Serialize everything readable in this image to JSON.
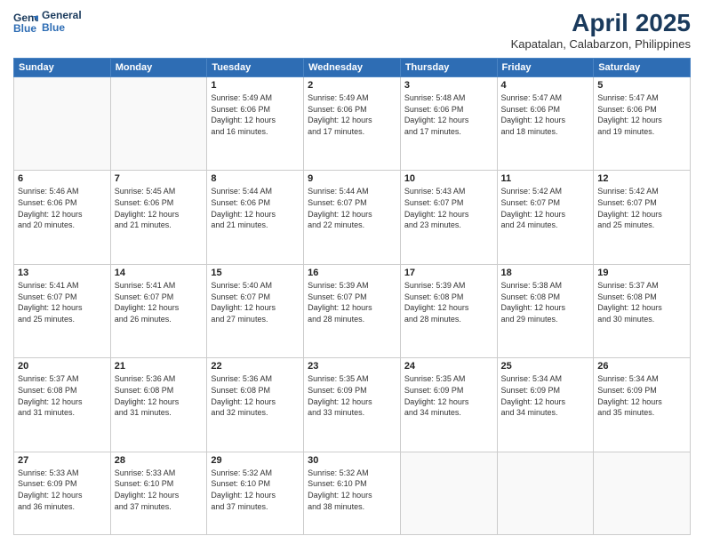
{
  "header": {
    "logo_line1": "General",
    "logo_line2": "Blue",
    "month_year": "April 2025",
    "location": "Kapatalan, Calabarzon, Philippines"
  },
  "weekdays": [
    "Sunday",
    "Monday",
    "Tuesday",
    "Wednesday",
    "Thursday",
    "Friday",
    "Saturday"
  ],
  "weeks": [
    [
      {
        "day": "",
        "info": ""
      },
      {
        "day": "",
        "info": ""
      },
      {
        "day": "1",
        "info": "Sunrise: 5:49 AM\nSunset: 6:06 PM\nDaylight: 12 hours\nand 16 minutes."
      },
      {
        "day": "2",
        "info": "Sunrise: 5:49 AM\nSunset: 6:06 PM\nDaylight: 12 hours\nand 17 minutes."
      },
      {
        "day": "3",
        "info": "Sunrise: 5:48 AM\nSunset: 6:06 PM\nDaylight: 12 hours\nand 17 minutes."
      },
      {
        "day": "4",
        "info": "Sunrise: 5:47 AM\nSunset: 6:06 PM\nDaylight: 12 hours\nand 18 minutes."
      },
      {
        "day": "5",
        "info": "Sunrise: 5:47 AM\nSunset: 6:06 PM\nDaylight: 12 hours\nand 19 minutes."
      }
    ],
    [
      {
        "day": "6",
        "info": "Sunrise: 5:46 AM\nSunset: 6:06 PM\nDaylight: 12 hours\nand 20 minutes."
      },
      {
        "day": "7",
        "info": "Sunrise: 5:45 AM\nSunset: 6:06 PM\nDaylight: 12 hours\nand 21 minutes."
      },
      {
        "day": "8",
        "info": "Sunrise: 5:44 AM\nSunset: 6:06 PM\nDaylight: 12 hours\nand 21 minutes."
      },
      {
        "day": "9",
        "info": "Sunrise: 5:44 AM\nSunset: 6:07 PM\nDaylight: 12 hours\nand 22 minutes."
      },
      {
        "day": "10",
        "info": "Sunrise: 5:43 AM\nSunset: 6:07 PM\nDaylight: 12 hours\nand 23 minutes."
      },
      {
        "day": "11",
        "info": "Sunrise: 5:42 AM\nSunset: 6:07 PM\nDaylight: 12 hours\nand 24 minutes."
      },
      {
        "day": "12",
        "info": "Sunrise: 5:42 AM\nSunset: 6:07 PM\nDaylight: 12 hours\nand 25 minutes."
      }
    ],
    [
      {
        "day": "13",
        "info": "Sunrise: 5:41 AM\nSunset: 6:07 PM\nDaylight: 12 hours\nand 25 minutes."
      },
      {
        "day": "14",
        "info": "Sunrise: 5:41 AM\nSunset: 6:07 PM\nDaylight: 12 hours\nand 26 minutes."
      },
      {
        "day": "15",
        "info": "Sunrise: 5:40 AM\nSunset: 6:07 PM\nDaylight: 12 hours\nand 27 minutes."
      },
      {
        "day": "16",
        "info": "Sunrise: 5:39 AM\nSunset: 6:07 PM\nDaylight: 12 hours\nand 28 minutes."
      },
      {
        "day": "17",
        "info": "Sunrise: 5:39 AM\nSunset: 6:08 PM\nDaylight: 12 hours\nand 28 minutes."
      },
      {
        "day": "18",
        "info": "Sunrise: 5:38 AM\nSunset: 6:08 PM\nDaylight: 12 hours\nand 29 minutes."
      },
      {
        "day": "19",
        "info": "Sunrise: 5:37 AM\nSunset: 6:08 PM\nDaylight: 12 hours\nand 30 minutes."
      }
    ],
    [
      {
        "day": "20",
        "info": "Sunrise: 5:37 AM\nSunset: 6:08 PM\nDaylight: 12 hours\nand 31 minutes."
      },
      {
        "day": "21",
        "info": "Sunrise: 5:36 AM\nSunset: 6:08 PM\nDaylight: 12 hours\nand 31 minutes."
      },
      {
        "day": "22",
        "info": "Sunrise: 5:36 AM\nSunset: 6:08 PM\nDaylight: 12 hours\nand 32 minutes."
      },
      {
        "day": "23",
        "info": "Sunrise: 5:35 AM\nSunset: 6:09 PM\nDaylight: 12 hours\nand 33 minutes."
      },
      {
        "day": "24",
        "info": "Sunrise: 5:35 AM\nSunset: 6:09 PM\nDaylight: 12 hours\nand 34 minutes."
      },
      {
        "day": "25",
        "info": "Sunrise: 5:34 AM\nSunset: 6:09 PM\nDaylight: 12 hours\nand 34 minutes."
      },
      {
        "day": "26",
        "info": "Sunrise: 5:34 AM\nSunset: 6:09 PM\nDaylight: 12 hours\nand 35 minutes."
      }
    ],
    [
      {
        "day": "27",
        "info": "Sunrise: 5:33 AM\nSunset: 6:09 PM\nDaylight: 12 hours\nand 36 minutes."
      },
      {
        "day": "28",
        "info": "Sunrise: 5:33 AM\nSunset: 6:10 PM\nDaylight: 12 hours\nand 37 minutes."
      },
      {
        "day": "29",
        "info": "Sunrise: 5:32 AM\nSunset: 6:10 PM\nDaylight: 12 hours\nand 37 minutes."
      },
      {
        "day": "30",
        "info": "Sunrise: 5:32 AM\nSunset: 6:10 PM\nDaylight: 12 hours\nand 38 minutes."
      },
      {
        "day": "",
        "info": ""
      },
      {
        "day": "",
        "info": ""
      },
      {
        "day": "",
        "info": ""
      }
    ]
  ]
}
